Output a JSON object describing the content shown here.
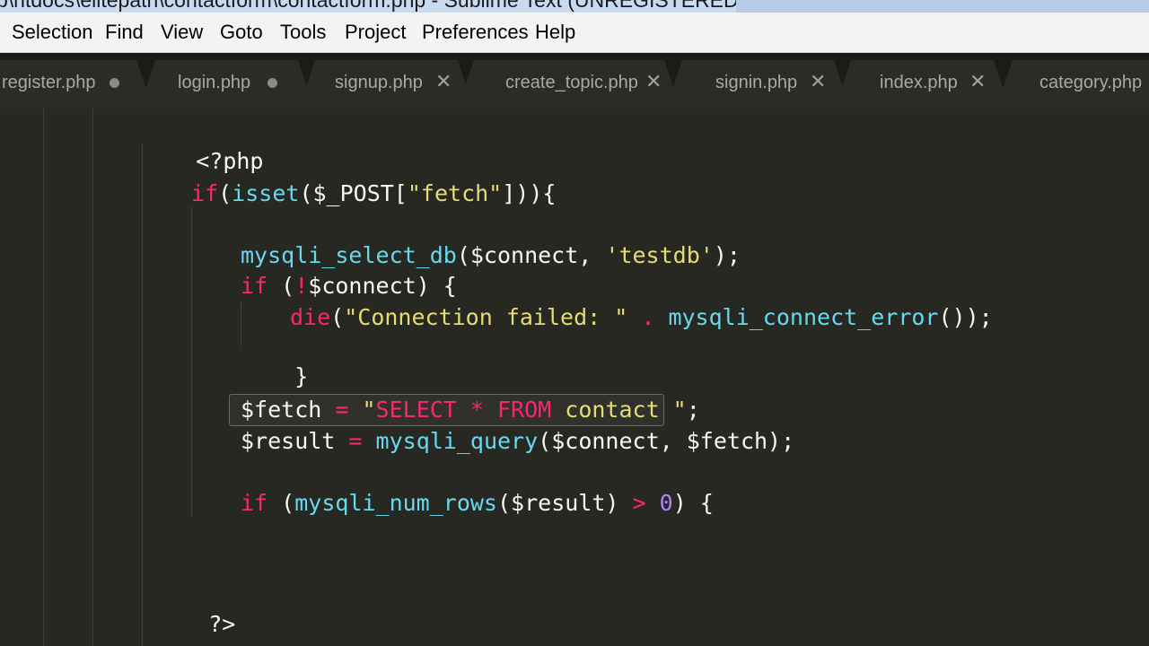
{
  "window": {
    "title": "p\\htdocs\\elitepath\\contactform\\contactform.php - Sublime Text (UNREGISTERED)"
  },
  "menu": [
    "Selection",
    "Find",
    "View",
    "Goto",
    "Tools",
    "Project",
    "Preferences",
    "Help"
  ],
  "tabs": [
    {
      "label": "register.php",
      "marker": "dirty"
    },
    {
      "label": "login.php",
      "marker": "dirty"
    },
    {
      "label": "signup.php",
      "marker": "close"
    },
    {
      "label": "create_topic.php",
      "marker": "close"
    },
    {
      "label": "signin.php",
      "marker": "close"
    },
    {
      "label": "index.php",
      "marker": "close"
    },
    {
      "label": "category.php",
      "marker": "none"
    }
  ],
  "icons": {
    "dirty": "dirty-dot-icon",
    "close": "close-x-icon"
  },
  "code": {
    "l1": {
      "a": "<?php"
    },
    "l2": {
      "a": "if",
      "b": "(",
      "c": "isset",
      "d": "($_POST[",
      "e": "\"fetch\"",
      "f": "])){"
    },
    "l3": {
      "a": "mysqli_select_db",
      "b": "($connect, ",
      "c": "'testdb'",
      "d": ");"
    },
    "l4": {
      "a": "if",
      "b": " (",
      "c": "!",
      "d": "$connect) {"
    },
    "l5": {
      "a": "die",
      "b": "(",
      "c": "\"Connection failed: \"",
      "d": " . ",
      "e": "mysqli_connect_error",
      "f": "());"
    },
    "l6": {
      "a": "}"
    },
    "l7": {
      "a": "$fetch ",
      "b": "=",
      "c": " ",
      "d": "\"",
      "e": "SELECT * FROM",
      "f": " contact \"",
      "g": ";"
    },
    "l8": {
      "a": "$result ",
      "b": "=",
      "c": " ",
      "d": "mysqli_query",
      "e": "($connect, $fetch);"
    },
    "l9": {
      "a": "if",
      "b": " (",
      "c": "mysqli_num_rows",
      "d": "($result) ",
      "e": ">",
      "f": " ",
      "g": "0",
      "h": ") {"
    },
    "l10": {
      "a": "?>"
    }
  },
  "colors": {
    "background": "#272822",
    "keyword": "#f92672",
    "function": "#66d9ef",
    "string": "#e6db74",
    "number": "#ae81ff",
    "text": "#f8f8f2"
  }
}
